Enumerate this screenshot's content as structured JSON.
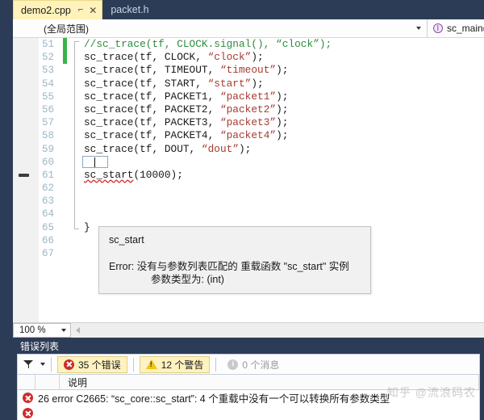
{
  "tabs": [
    {
      "label": "demo2.cpp",
      "active": true,
      "pin_icon": "pin-icon",
      "close_icon": "close-icon"
    },
    {
      "label": "packet.h",
      "active": false
    }
  ],
  "navbar": {
    "scope": "(全局范围)",
    "member": "sc_main(i",
    "member_icon": "method-icon",
    "caret_icon": "chevron-down-icon"
  },
  "editor": {
    "lines": [
      {
        "num": "51",
        "html": "<span class=\"cmt\">//sc_trace(tf, CLOCK.signal(), “clock”);</span>",
        "change": "green",
        "struct": "top"
      },
      {
        "num": "52",
        "html": "sc_trace(tf, CLOCK, <span class=\"str\">“clock”</span>);",
        "change": "green",
        "struct": "mid"
      },
      {
        "num": "53",
        "html": "sc_trace(tf, TIMEOUT, <span class=\"str\">“timeout”</span>);",
        "struct": "mid"
      },
      {
        "num": "54",
        "html": "sc_trace(tf, START, <span class=\"str\">“start”</span>);",
        "struct": "mid"
      },
      {
        "num": "55",
        "html": "sc_trace(tf, PACKET1, <span class=\"str\">“packet1”</span>);",
        "struct": "mid"
      },
      {
        "num": "56",
        "html": "sc_trace(tf, PACKET2, <span class=\"str\">“packet2”</span>);",
        "struct": "mid"
      },
      {
        "num": "57",
        "html": "sc_trace(tf, PACKET3, <span class=\"str\">“packet3”</span>);",
        "struct": "mid"
      },
      {
        "num": "58",
        "html": "sc_trace(tf, PACKET4, <span class=\"str\">“packet4”</span>);",
        "struct": "mid"
      },
      {
        "num": "59",
        "html": "sc_trace(tf, DOUT, <span class=\"str\">“dout”</span>);",
        "struct": "mid"
      },
      {
        "num": "60",
        "html": "",
        "struct": "mid",
        "caret": true
      },
      {
        "num": "61",
        "html": "<span class=\"squig\">sc_start</span>(10000);",
        "struct": "mid",
        "collapse": true
      },
      {
        "num": "62",
        "html": "",
        "struct": "mid"
      },
      {
        "num": "63",
        "html": "",
        "struct": "mid"
      },
      {
        "num": "64",
        "html": "",
        "struct": "mid"
      },
      {
        "num": "65",
        "html": "}",
        "struct": "bot"
      },
      {
        "num": "66",
        "html": ""
      },
      {
        "num": "67",
        "html": ""
      }
    ]
  },
  "tooltip": {
    "title": "sc_start",
    "error_line1": "Error: 没有与参数列表匹配的 重载函数 \"sc_start\" 实例",
    "error_line2": "参数类型为: (int)"
  },
  "ed_footer": {
    "zoom": "100 %",
    "zoom_caret_icon": "chevron-down-icon",
    "hscroll_left_icon": "scroll-left-arrow-icon"
  },
  "error_list": {
    "title": "错误列表",
    "filter_icon": "filter-icon",
    "filter_caret_icon": "chevron-down-icon",
    "chips": [
      {
        "label": "35 个错误",
        "icon": "error-icon",
        "active": true
      },
      {
        "label": "12 个警告",
        "icon": "warning-icon",
        "active": true
      },
      {
        "label": "0 个消息",
        "icon": "info-icon",
        "active": false
      }
    ],
    "columns": [
      "",
      "",
      "说明"
    ],
    "rows": [
      {
        "icon": "error-icon",
        "text": "26  error C2665: “sc_core::sc_start”: 4 个重载中没有一个可以转换所有参数类型"
      }
    ]
  },
  "watermark": "知乎 @流浪码农",
  "colors": {
    "chrome": "#2d3c56",
    "active_tab": "#fff2ba",
    "error_red": "#cf2b2b",
    "warning_yellow": "#f0c419",
    "change_green": "#36b449",
    "comment_green": "#2e8b3d",
    "string_red": "#a63a2e"
  }
}
